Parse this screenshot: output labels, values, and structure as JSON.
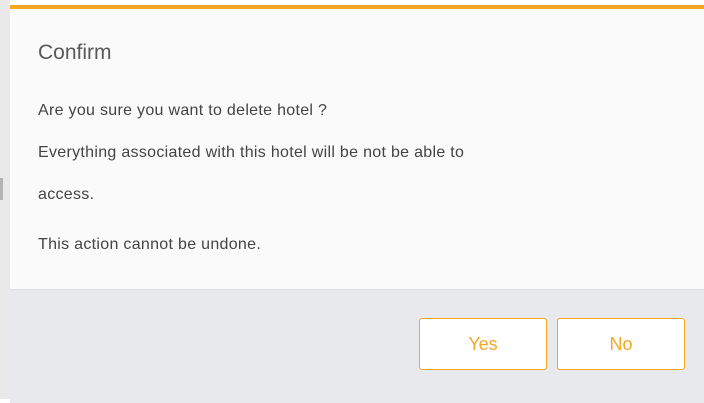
{
  "dialog": {
    "title": "Confirm",
    "message_lines": [
      "Are you sure you want to delete hotel ?",
      "Everything associated with this hotel will be not be able to",
      "access.",
      "This action cannot be undone."
    ],
    "accent_color": "#f5a623",
    "buttons": {
      "yes_label": "Yes",
      "no_label": "No"
    }
  }
}
